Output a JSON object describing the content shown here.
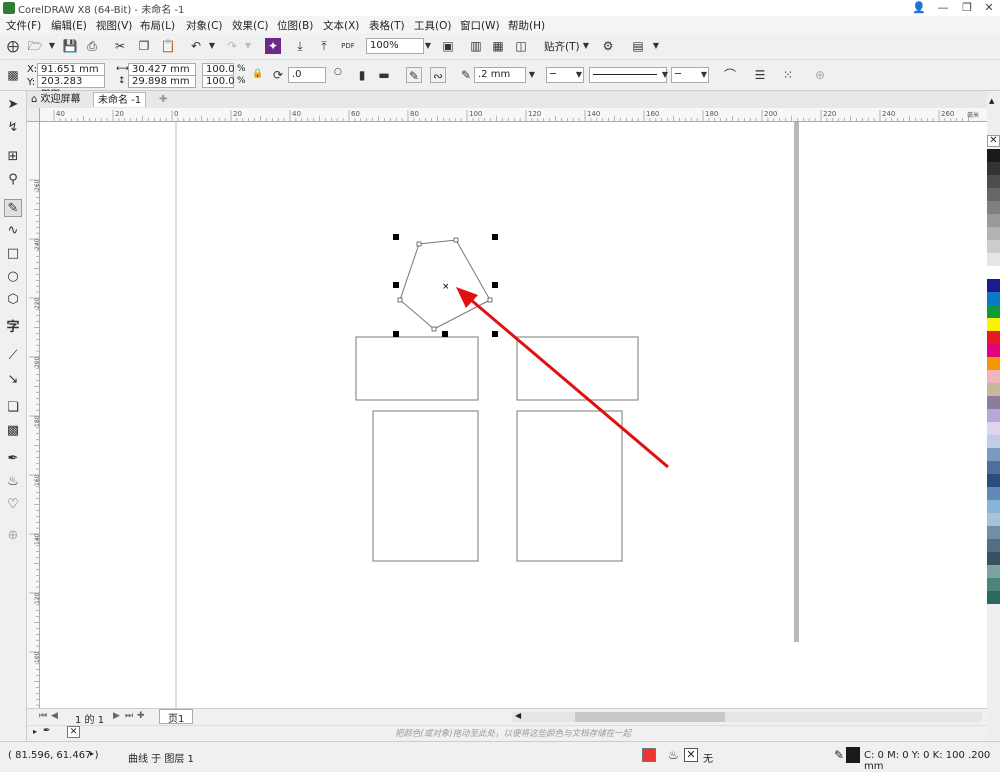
{
  "window": {
    "title": "CorelDRAW X8 (64-Bit) - 未命名 -1"
  },
  "menu": [
    "文件(F)",
    "编辑(E)",
    "视图(V)",
    "布局(L)",
    "对象(C)",
    "效果(C)",
    "位图(B)",
    "文本(X)",
    "表格(T)",
    "工具(O)",
    "窗口(W)",
    "帮助(H)"
  ],
  "toolbar": {
    "zoom": "100%",
    "snap_label": "贴齐(T)",
    "pdf_label": "PDF"
  },
  "props": {
    "x": "91.651 mm",
    "y": "203.283 mm",
    "w": "30.427 mm",
    "h": "29.898 mm",
    "sx": "100.0",
    "sy": "100.0",
    "pct": "%",
    "angle": ".0",
    "outline": ".2 mm"
  },
  "tabs": {
    "welcome": "欢迎屏幕",
    "doc": "未命名 -1"
  },
  "ruler_h": [
    "40",
    "20",
    "0",
    "20",
    "40",
    "60",
    "80",
    "100",
    "120",
    "140",
    "160",
    "180",
    "200",
    "220",
    "240",
    "260"
  ],
  "ruler_v": [
    "260",
    "240",
    "220",
    "200",
    "180",
    "160",
    "140",
    "120",
    "100",
    "80"
  ],
  "ruler_unit": "毫米",
  "pagebar": {
    "page_count": "1 的 1",
    "page_tab": "页1"
  },
  "hint": "把颜色(或对象)拖动至此处，以便将这些颜色与文档存储在一起",
  "status": {
    "coords": "( 81.596, 61.467 )",
    "info": "曲线 于 图层 1",
    "fill": "无",
    "color_info": "C: 0 M: 0 Y: 0 K: 100  .200 mm"
  },
  "palette_colors": [
    "#1a1a1a",
    "#333333",
    "#4d4d4d",
    "#666666",
    "#808080",
    "#999999",
    "#b3b3b3",
    "#cccccc",
    "#e6e6e6",
    "#ffffff",
    "#1b1b8f",
    "#0a77c7",
    "#0a9c3c",
    "#fff200",
    "#e31b23",
    "#e5007e",
    "#f39800",
    "#f2b5c0",
    "#c8b89a",
    "#8b7d9b",
    "#b3aad9",
    "#e0d4ef",
    "#bfcde9",
    "#7a9ac0",
    "#4f6e9b",
    "#2b4c7e",
    "#5e8ab4",
    "#88b4d8",
    "#a9c2d9",
    "#6e8fa8",
    "#526e84",
    "#3a4f60",
    "#7fa3a0",
    "#4b8579",
    "#2a6a5e"
  ]
}
